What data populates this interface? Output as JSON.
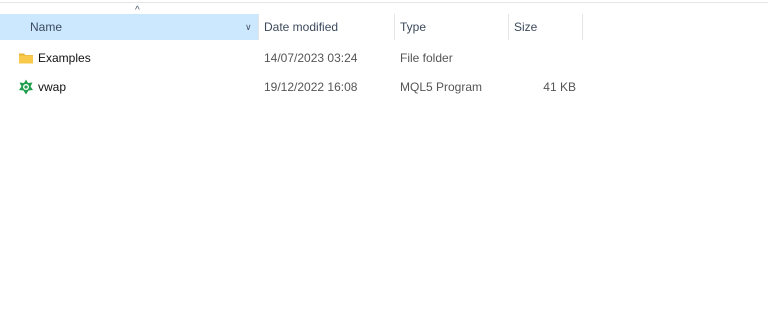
{
  "columns": {
    "name": "Name",
    "date_modified": "Date modified",
    "type": "Type",
    "size": "Size"
  },
  "sort_indicator": "^",
  "files": [
    {
      "icon": "folder-icon",
      "name": "Examples",
      "date_modified": "14/07/2023 03:24",
      "type": "File folder",
      "size": ""
    },
    {
      "icon": "mql5-program-icon",
      "name": "vwap",
      "date_modified": "19/12/2022 16:08",
      "type": "MQL5 Program",
      "size": "41 KB"
    }
  ],
  "colors": {
    "selected_column_bg": "#cce8ff",
    "folder_yellow": "#f8c94a",
    "program_green": "#1e9e4a"
  }
}
